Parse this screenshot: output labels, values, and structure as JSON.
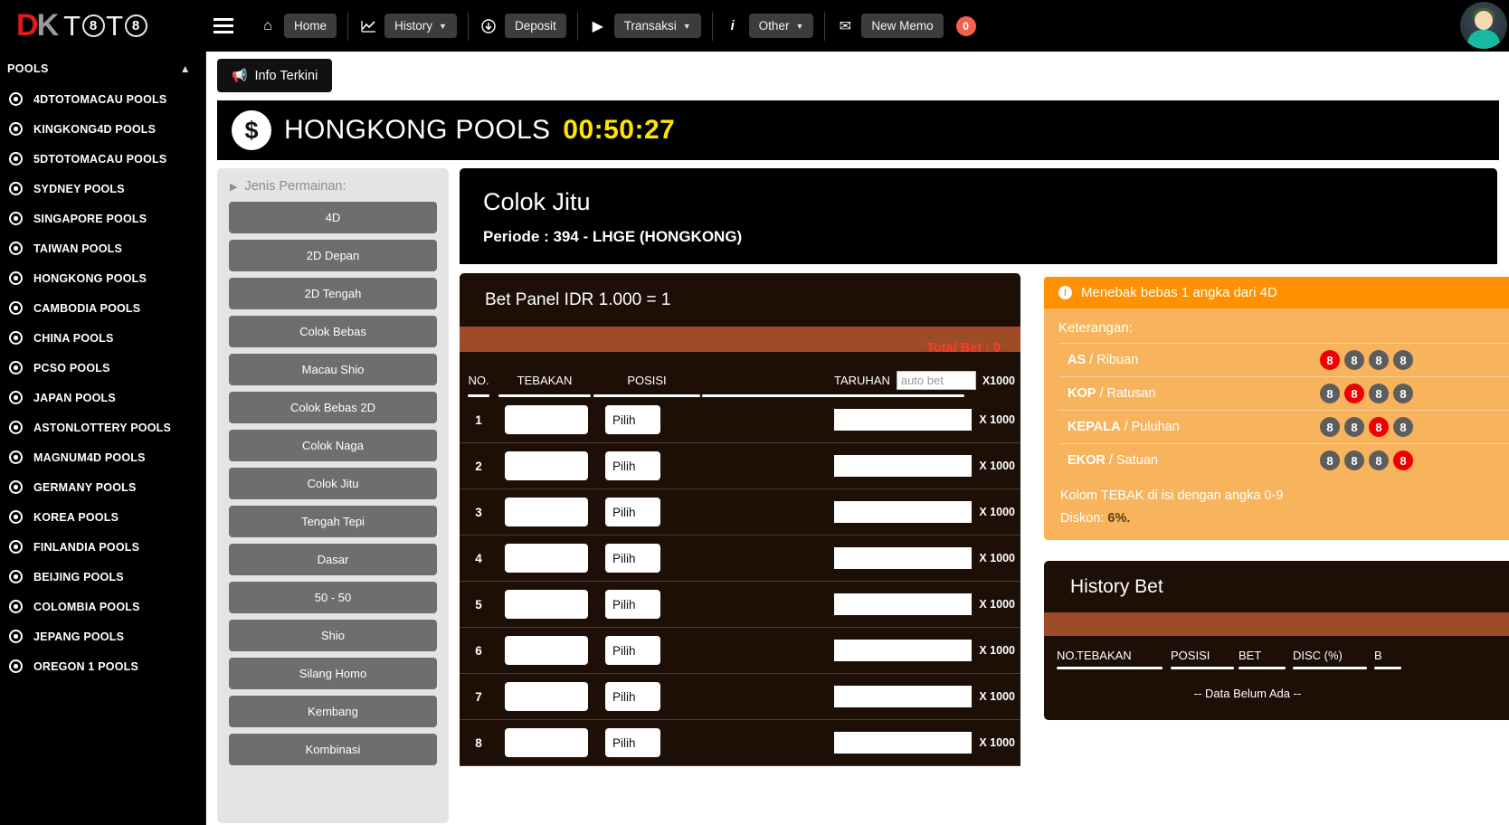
{
  "brand": {
    "logo_d": "D",
    "logo_k": "K",
    "logo_t1": "T",
    "logo_ball1": "8",
    "logo_t2": "T",
    "logo_ball2": "8"
  },
  "topnav": {
    "menu_icon": "hamburger-icon",
    "items": [
      {
        "icon": "home-icon",
        "glyph": "⌂",
        "label": "Home",
        "caret": false
      },
      {
        "icon": "chart-icon",
        "glyph": "↗",
        "label": "History",
        "caret": true
      },
      {
        "icon": "deposit-icon",
        "glyph": "⬇",
        "label": "Deposit",
        "caret": false
      },
      {
        "icon": "play-icon",
        "glyph": "▶",
        "label": "Transaksi",
        "caret": true
      },
      {
        "icon": "info-icon",
        "glyph": "i",
        "label": "Other",
        "caret": true
      },
      {
        "icon": "mail-icon",
        "glyph": "✉",
        "label": "New Memo",
        "caret": false
      }
    ],
    "memo_count": "0"
  },
  "sidebar": {
    "section_title": "POOLS",
    "collapse_icon": "chevron-up-icon",
    "items": [
      {
        "label": "4DTOTOMACAU POOLS"
      },
      {
        "label": "KINGKONG4D POOLS"
      },
      {
        "label": "5DTOTOMACAU POOLS"
      },
      {
        "label": "SYDNEY POOLS"
      },
      {
        "label": "SINGAPORE POOLS"
      },
      {
        "label": "TAIWAN POOLS"
      },
      {
        "label": "HONGKONG POOLS"
      },
      {
        "label": "CAMBODIA POOLS"
      },
      {
        "label": "CHINA POOLS"
      },
      {
        "label": "PCSO POOLS"
      },
      {
        "label": "JAPAN POOLS"
      },
      {
        "label": "ASTONLOTTERY POOLS"
      },
      {
        "label": "MAGNUM4D POOLS"
      },
      {
        "label": "GERMANY POOLS"
      },
      {
        "label": "KOREA POOLS"
      },
      {
        "label": "FINLANDIA POOLS"
      },
      {
        "label": "BEIJING POOLS"
      },
      {
        "label": "COLOMBIA POOLS"
      },
      {
        "label": "JEPANG POOLS"
      },
      {
        "label": "OREGON 1 POOLS"
      }
    ]
  },
  "main": {
    "info_button": "Info Terkini",
    "pool_banner": {
      "currency_symbol": "$",
      "title": "HONGKONG POOLS",
      "timer": "00:50:27"
    },
    "jenis": {
      "heading": "Jenis Permainan:",
      "buttons": [
        "4D",
        "2D Depan",
        "2D Tengah",
        "Colok Bebas",
        "Macau Shio",
        "Colok Bebas 2D",
        "Colok Naga",
        "Colok Jitu",
        "Tengah Tepi",
        "Dasar",
        "50 - 50",
        "Shio",
        "Silang Homo",
        "Kembang",
        "Kombinasi"
      ]
    },
    "game_header": {
      "title": "Colok Jitu",
      "period": "Periode : 394 - LHGE (HONGKONG)"
    },
    "bet_panel": {
      "title": "Bet Panel IDR 1.000 = 1",
      "total_bet": "Total Bet : 0",
      "columns": {
        "no": "NO.",
        "tebakan": "TEBAKAN",
        "posisi": "POSISI",
        "taruhan": "TARUHAN",
        "multiplier": "X1000"
      },
      "auto_bet_placeholder": "auto bet",
      "auto_bet_value": "",
      "row_multiplier": "X 1000",
      "posisi_button": "Pilih",
      "rows": [
        {
          "no": "1",
          "tebakan": "",
          "posisi": "Pilih",
          "taruhan": ""
        },
        {
          "no": "2",
          "tebakan": "",
          "posisi": "Pilih",
          "taruhan": ""
        },
        {
          "no": "3",
          "tebakan": "",
          "posisi": "Pilih",
          "taruhan": ""
        },
        {
          "no": "4",
          "tebakan": "",
          "posisi": "Pilih",
          "taruhan": ""
        },
        {
          "no": "5",
          "tebakan": "",
          "posisi": "Pilih",
          "taruhan": ""
        },
        {
          "no": "6",
          "tebakan": "",
          "posisi": "Pilih",
          "taruhan": ""
        },
        {
          "no": "7",
          "tebakan": "",
          "posisi": "Pilih",
          "taruhan": ""
        },
        {
          "no": "8",
          "tebakan": "",
          "posisi": "Pilih",
          "taruhan": ""
        }
      ]
    },
    "keterangan": {
      "header": "Menebak bebas 1 angka dari 4D",
      "label": "Keterangan:",
      "rows": [
        {
          "bold": "AS",
          "rest": " / Ribuan",
          "digits": [
            "8",
            "8",
            "8",
            "8"
          ],
          "highlight": 0
        },
        {
          "bold": "KOP",
          "rest": " / Ratusan",
          "digits": [
            "8",
            "8",
            "8",
            "8"
          ],
          "highlight": 1
        },
        {
          "bold": "KEPALA",
          "rest": " / Puluhan",
          "digits": [
            "8",
            "8",
            "8",
            "8"
          ],
          "highlight": 2
        },
        {
          "bold": "EKOR",
          "rest": " / Satuan",
          "digits": [
            "8",
            "8",
            "8",
            "8"
          ],
          "highlight": 3
        }
      ],
      "note": "Kolom TEBAK di isi dengan angka 0-9",
      "discount_label": "Diskon: ",
      "discount_value": "6%."
    },
    "history_bet": {
      "title": "History Bet",
      "columns": [
        "NO.",
        "TEBAKAN",
        "POSISI",
        "BET",
        "DISC (%)",
        "B"
      ],
      "empty_text": "-- Data Belum Ada --"
    }
  },
  "colors": {
    "accent_orange": "#ff9000",
    "panel_orange": "#f7b45c",
    "dark_brown": "#1d0f06",
    "stripe_brown": "#9e4c27",
    "timer_yellow": "#ffe400",
    "total_bet_red": "#ff3b2f",
    "ball_hot": "#ee0000",
    "ball_cold": "#5d5d5d",
    "logo_red": "#e01b1b"
  }
}
